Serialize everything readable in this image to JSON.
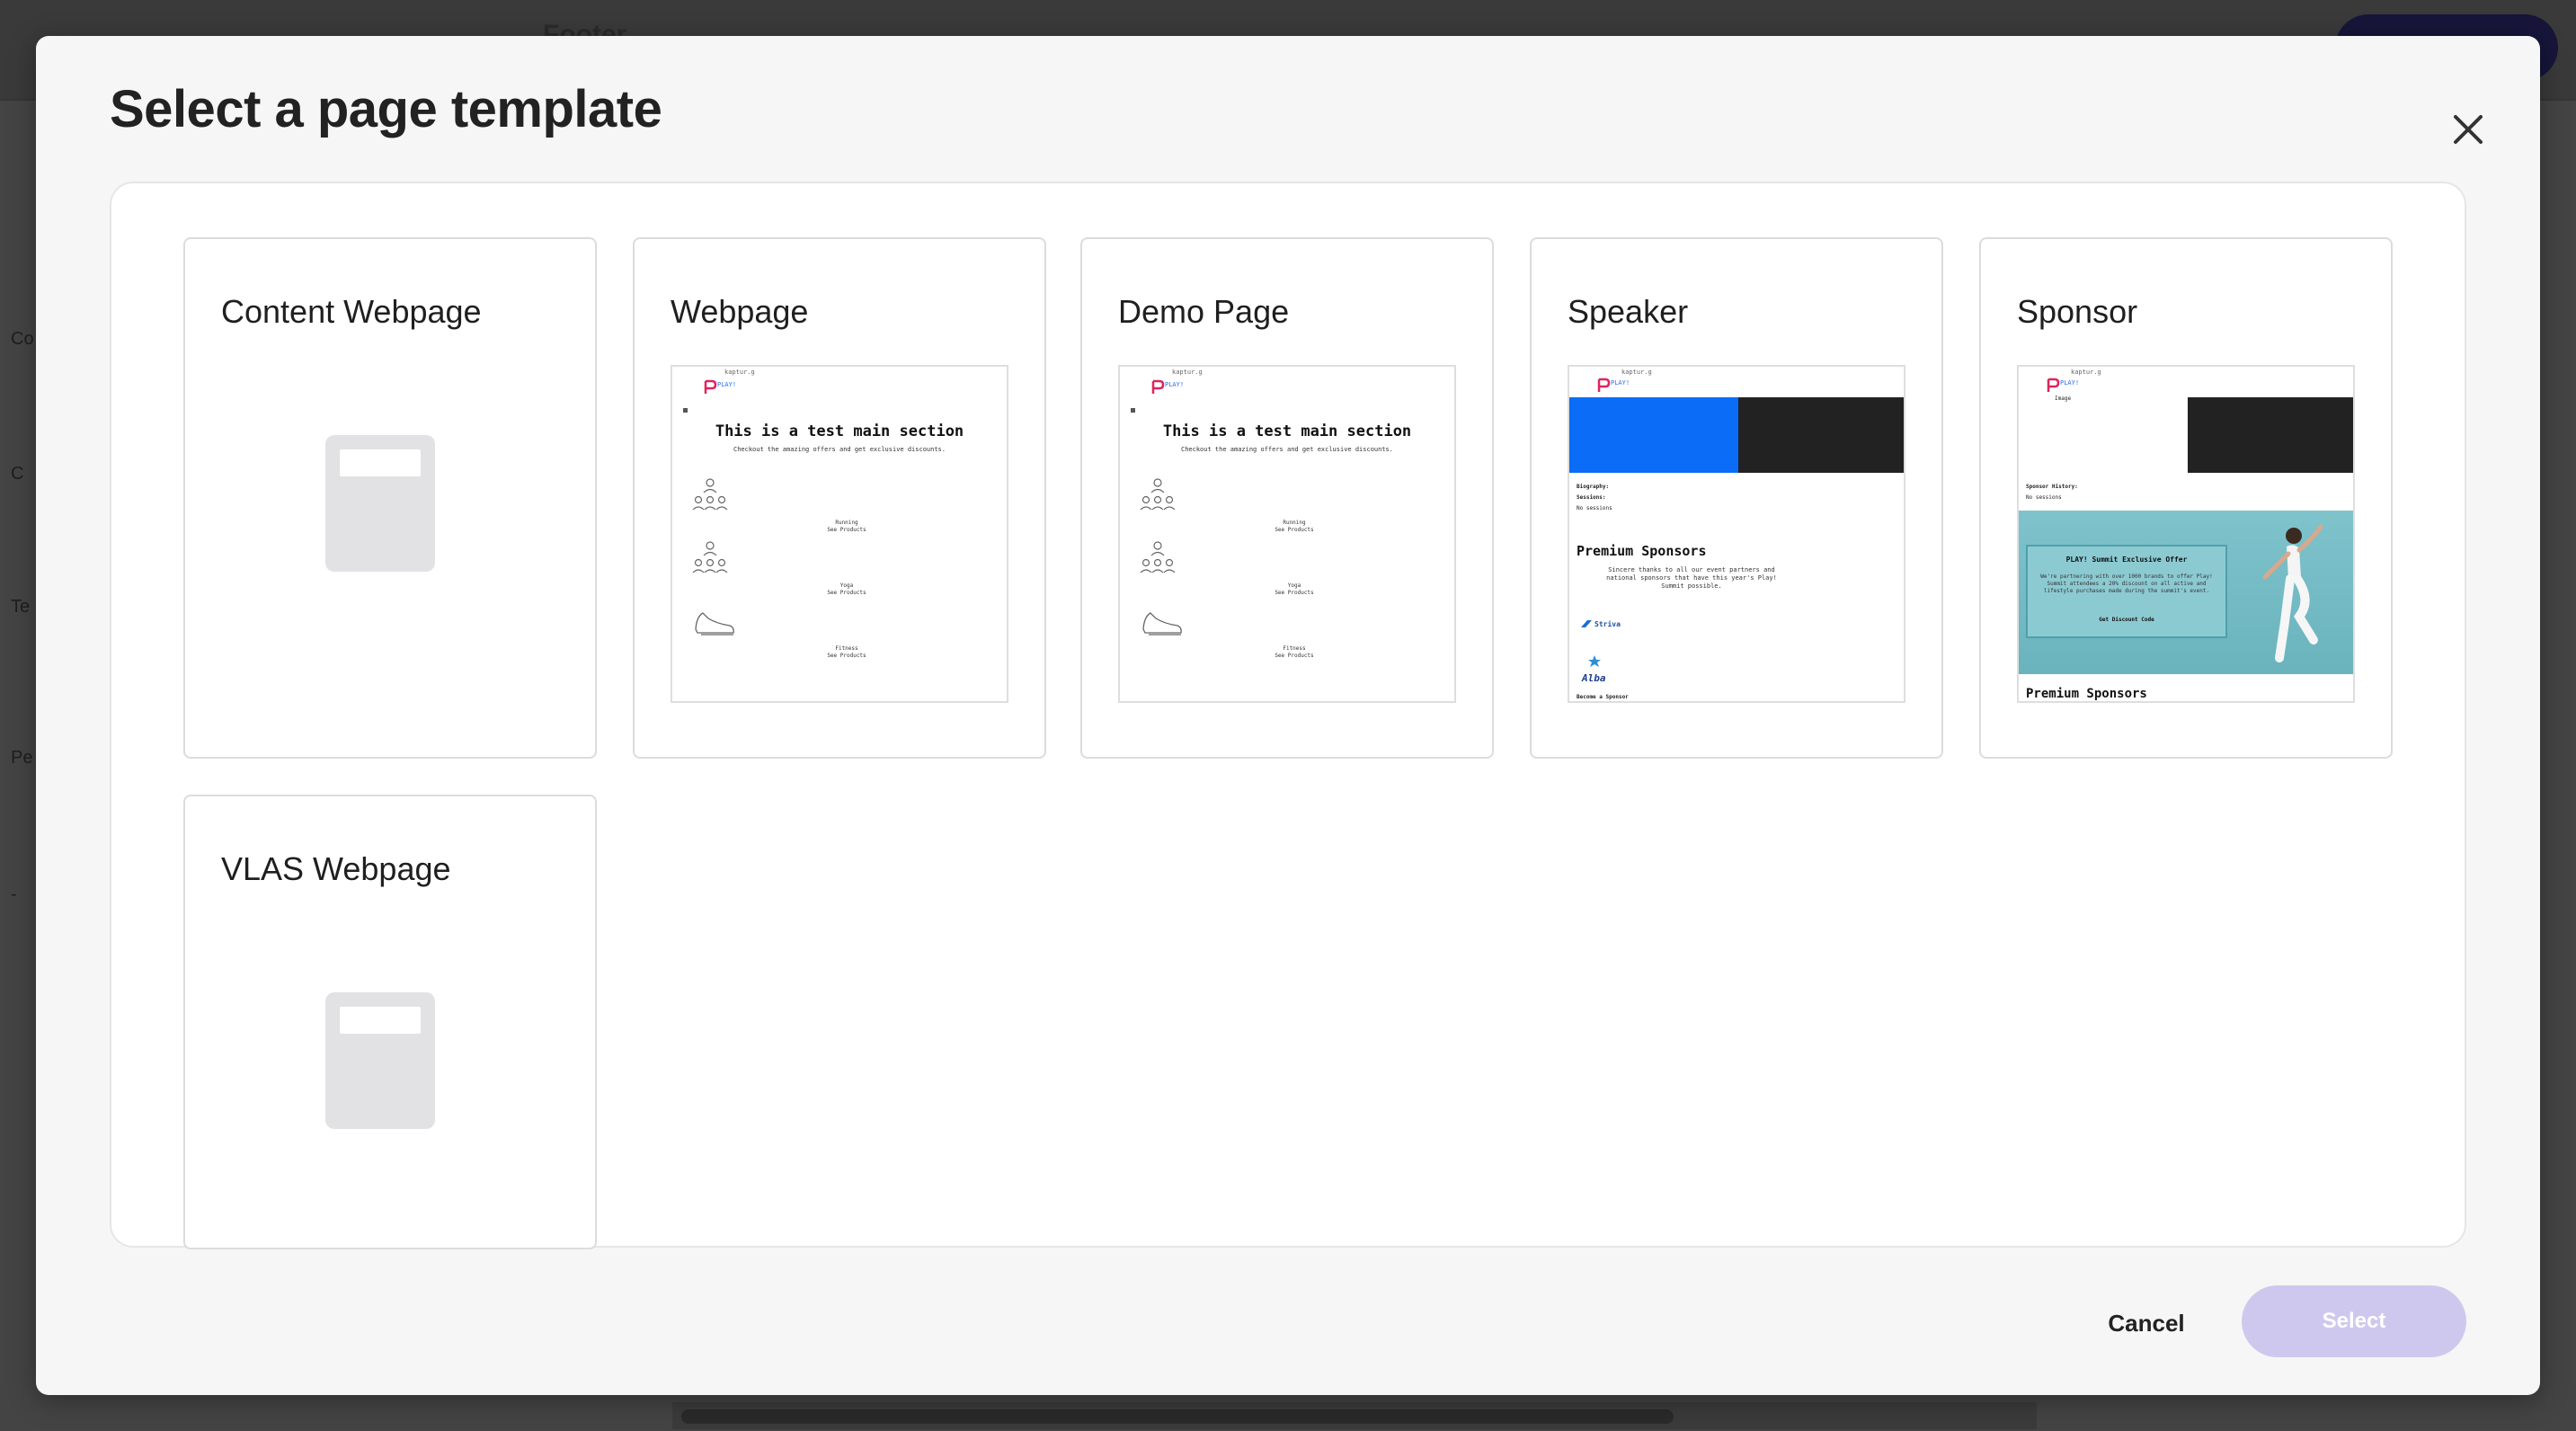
{
  "background": {
    "topbar_title": "Footer",
    "side_labels": [
      "Co",
      "C",
      "Te",
      "Pe",
      "-"
    ]
  },
  "modal": {
    "title": "Select a page template",
    "close_icon": "close-icon"
  },
  "templates": [
    {
      "name": "Content Webpage",
      "preview": "placeholder"
    },
    {
      "name": "Webpage",
      "preview": "webpage-thumbnail"
    },
    {
      "name": "Demo Page",
      "preview": "webpage-thumbnail"
    },
    {
      "name": "Speaker",
      "preview": "speaker-thumbnail"
    },
    {
      "name": "Sponsor",
      "preview": "sponsor-thumbnail"
    },
    {
      "name": "VLAS Webpage",
      "preview": "placeholder"
    }
  ],
  "thumbnail": {
    "url": "kaptur.g",
    "play_label": "PLAY!",
    "main_section": "This is a test main section",
    "main_sub": "Checkout the amazing offers and get exclusive discounts.",
    "running": "Running",
    "yoga": "Yoga",
    "fitness": "Fitness",
    "see_products": "See Products"
  },
  "speaker_thumb": {
    "biography": "Biography:",
    "sessions": "Sessions:",
    "no_sessions": "No sessions",
    "premium": "Premium Sponsors",
    "premium_sub": "Sincere thanks to all our event partners and national sponsors that have this year's Play! Summit possible.",
    "striva": "Striva",
    "alba": "Alba",
    "become": "Become a Sponsor"
  },
  "sponsor_thumb": {
    "image": "Image",
    "history": "Sponsor History:",
    "no_sessions": "No sessions",
    "offer_title": "PLAY! Summit Exclusive Offer",
    "offer_text": "We're partnering with over 1000 brands to offer Play! Summit attendees a 20% discount on all active and lifestyle purchases made during the summit's event.",
    "discount_code": "Get Discount Code",
    "premium": "Premium Sponsors"
  },
  "footer": {
    "cancel_label": "Cancel",
    "select_label": "Select"
  },
  "colors": {
    "select_disabled": "#cfc8ee",
    "brand_blue": "#0a6cf7",
    "overlay": "#434343"
  }
}
